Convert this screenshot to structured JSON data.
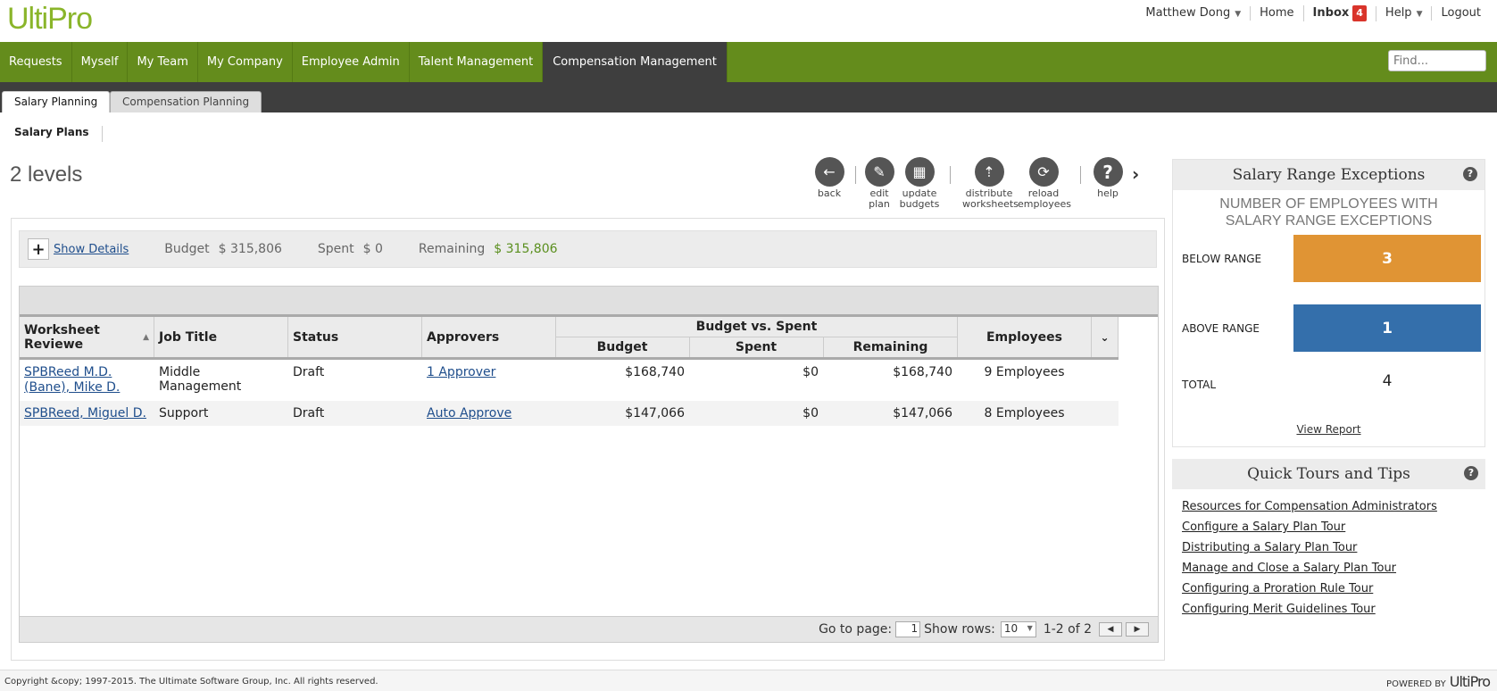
{
  "header": {
    "logo": "UltiPro",
    "user": "Matthew Dong",
    "home": "Home",
    "inbox": "Inbox",
    "inbox_count": "4",
    "help": "Help",
    "logout": "Logout"
  },
  "nav": {
    "items": [
      "Requests",
      "Myself",
      "My Team",
      "My Company",
      "Employee Admin",
      "Talent Management",
      "Compensation Management"
    ],
    "find_placeholder": "Find..."
  },
  "tabs": [
    "Salary Planning",
    "Compensation Planning"
  ],
  "breadcrumb": "Salary Plans",
  "page_title": "2 levels",
  "toolbar": {
    "back": "back",
    "edit": [
      "edit",
      "plan"
    ],
    "update": [
      "update",
      "budgets"
    ],
    "distribute": [
      "distribute",
      "worksheets"
    ],
    "reload": [
      "reload",
      "employees"
    ],
    "help": "help"
  },
  "summary": {
    "show_details": "Show Details",
    "budget_label": "Budget",
    "budget_value": "$ 315,806",
    "spent_label": "Spent",
    "spent_value": "$ 0",
    "remaining_label": "Remaining",
    "remaining_value": "$ 315,806"
  },
  "grid": {
    "headers": {
      "reviewer": "Worksheet Reviewe",
      "job": "Job Title",
      "status": "Status",
      "approvers": "Approvers",
      "bvs": "Budget vs. Spent",
      "budget": "Budget",
      "spent": "Spent",
      "remaining": "Remaining",
      "employees": "Employees"
    },
    "rows": [
      {
        "reviewer": "SPBReed M.D. (Bane), Mike D.",
        "job": "Middle Management",
        "status": "Draft",
        "approvers": "1 Approver",
        "budget": "$168,740",
        "spent": "$0",
        "remaining": "$168,740",
        "employees": "9 Employees"
      },
      {
        "reviewer": "SPBReed, Miguel D.",
        "job": "Support",
        "status": "Draft",
        "approvers": "Auto Approve",
        "budget": "$147,066",
        "spent": "$0",
        "remaining": "$147,066",
        "employees": "8 Employees"
      }
    ],
    "footer": {
      "goto": "Go to page:",
      "page": "1",
      "show_rows": "Show rows:",
      "rows": "10",
      "range": "1-2 of 2"
    }
  },
  "sre": {
    "title": "Salary Range Exceptions",
    "subtitle": "NUMBER OF EMPLOYEES WITH SALARY RANGE EXCEPTIONS",
    "below_label": "BELOW RANGE",
    "below_value": "3",
    "above_label": "ABOVE RANGE",
    "above_value": "1",
    "total_label": "TOTAL",
    "total_value": "4",
    "view_report": "View Report",
    "below_color": "#e09434",
    "above_color": "#346fab"
  },
  "tips": {
    "title": "Quick Tours and Tips",
    "links": [
      "Resources for Compensation Administrators",
      "Configure a Salary Plan Tour",
      "Distributing a Salary Plan Tour",
      "Manage and Close a Salary Plan Tour",
      "Configuring a Proration Rule Tour",
      "Configuring Merit Guidelines Tour"
    ]
  },
  "footer": {
    "copyright": "Copyright &copy; 1997-2015. The Ultimate Software Group, Inc. All rights reserved.",
    "powered": "POWERED BY",
    "brand": "UltiPro"
  }
}
